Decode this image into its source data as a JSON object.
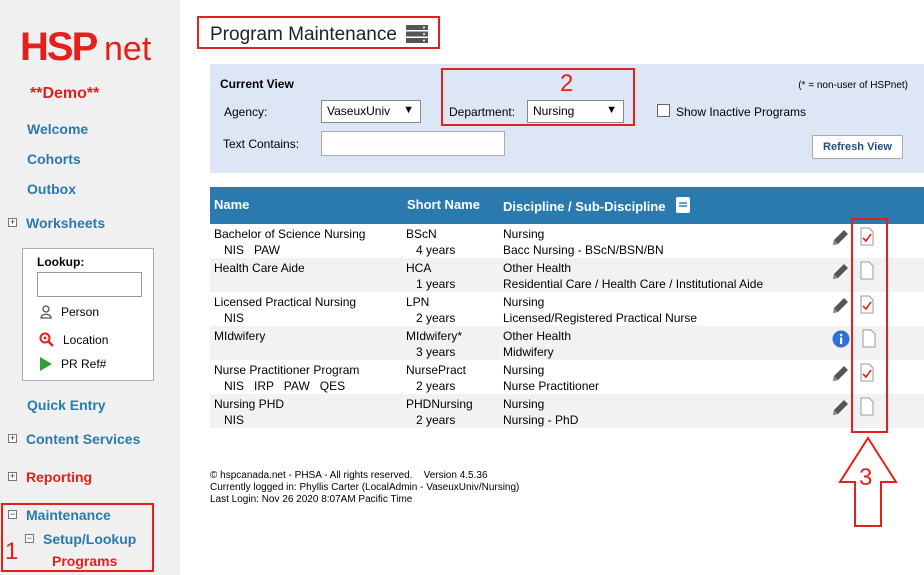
{
  "sidebar": {
    "logo_text": "HSPnet",
    "demo_label": "**Demo**",
    "items": {
      "welcome": "Welcome",
      "cohorts": "Cohorts",
      "outbox": "Outbox",
      "worksheets": "Worksheets",
      "quick_entry": "Quick Entry",
      "content_services": "Content Services",
      "reporting": "Reporting",
      "maintenance": "Maintenance",
      "setup_lookup": "Setup/Lookup",
      "programs": "Programs"
    },
    "lookup": {
      "title": "Lookup:",
      "input_value": "",
      "person": "Person",
      "location": "Location",
      "pr_ref": "PR Ref#"
    }
  },
  "header": {
    "title": "Program Maintenance"
  },
  "current_view": {
    "title": "Current View",
    "nonuser_note": "(* = non-user of HSPnet)",
    "agency_label": "Agency:",
    "agency_value": "VaseuxUniv",
    "department_label": "Department:",
    "department_value": "Nursing",
    "show_inactive_label": "Show Inactive Programs",
    "show_inactive_checked": false,
    "text_contains_label": "Text Contains:",
    "text_contains_value": "",
    "refresh_label": "Refresh View"
  },
  "table": {
    "headers": {
      "name": "Name",
      "short_name": "Short Name",
      "discipline": "Discipline / Sub-Discipline"
    },
    "rows": [
      {
        "name": "Bachelor of Science Nursing",
        "tags": "NIS   PAW",
        "short": "BScN",
        "years": "4 years",
        "discipline": "Nursing",
        "sub": "Bacc Nursing - BScN/BSN/BN",
        "action": "edit-icon",
        "doc": "checked-document-icon"
      },
      {
        "name": "Health Care Aide",
        "tags": "",
        "short": "HCA",
        "years": "1 years",
        "discipline": "Other Health",
        "sub": "Residential Care / Health Care / Institutional Aide",
        "action": "edit-icon",
        "doc": "document-icon"
      },
      {
        "name": "Licensed Practical Nursing",
        "tags": "NIS",
        "short": "LPN",
        "years": "2 years",
        "discipline": "Nursing",
        "sub": "Licensed/Registered Practical Nurse",
        "action": "edit-icon",
        "doc": "checked-document-icon"
      },
      {
        "name": "MIdwifery",
        "tags": "",
        "short": "MIdwifery*",
        "years": "3 years",
        "discipline": "Other Health",
        "sub": "Midwifery",
        "action": "info-icon",
        "doc": "document-icon"
      },
      {
        "name": "Nurse Practitioner Program",
        "tags": "NIS   IRP   PAW   QES",
        "short": "NursePract",
        "years": "2 years",
        "discipline": "Nursing",
        "sub": "Nurse Practitioner",
        "action": "edit-icon",
        "doc": "checked-document-icon"
      },
      {
        "name": "Nursing PHD",
        "tags": "NIS",
        "short": "PHDNursing",
        "years": "2 years",
        "discipline": "Nursing",
        "sub": "Nursing - PhD",
        "action": "edit-icon",
        "doc": "document-icon"
      }
    ]
  },
  "footer": {
    "line1": "© hspcanada.net - PHSA - All rights reserved.    Version 4.5.36",
    "line2": "Currently logged in: Phyllis Carter (LocalAdmin - VaseuxUniv/Nursing)",
    "line3": "Last Login: Nov 26 2020  8:07AM Pacific Time"
  },
  "annotations": {
    "n1": "1",
    "n2": "2",
    "n3": "3"
  },
  "colors": {
    "accent": "#2a7ab0",
    "brand_red": "#e3201b",
    "panel": "#dde6f5"
  }
}
